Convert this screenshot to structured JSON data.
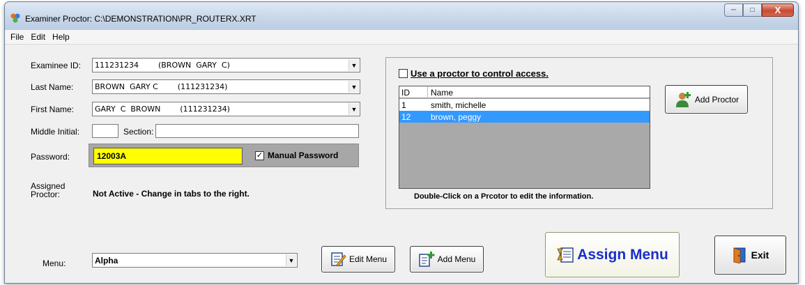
{
  "window": {
    "title": "Examiner Proctor: C:\\DEMONSTRATION\\PR_ROUTERX.XRT"
  },
  "menu": [
    "File",
    "Edit",
    "Help"
  ],
  "form": {
    "examinee_id_label": "Examinee ID:",
    "examinee_id_value": "111231234        (BROWN  GARY  C)",
    "last_name_label": "Last Name:",
    "last_name_value": "BROWN  GARY C        (111231234)",
    "first_name_label": "First Name:",
    "first_name_value": "GARY  C  BROWN        (111231234)",
    "middle_initial_label": "Middle Initial:",
    "middle_initial_value": "",
    "section_label": "Section:",
    "section_value": "",
    "password_label": "Password:",
    "password_value": "12003A",
    "manual_password_label": "Manual Password",
    "manual_password_checked": true,
    "assigned_proctor_label_line1": "Assigned",
    "assigned_proctor_label_line2": "Proctor:",
    "assigned_proctor_status": "Not Active - Change in tabs to the right.",
    "menu_label": "Menu:",
    "menu_value": "Alpha"
  },
  "proctor": {
    "use_proctor_label": "Use a proctor to control access.",
    "use_proctor_checked": false,
    "columns": [
      "ID",
      "Name"
    ],
    "rows": [
      {
        "id": "1",
        "name": "smith, michelle",
        "selected": false
      },
      {
        "id": "12",
        "name": "brown, peggy",
        "selected": true
      }
    ],
    "hint": "Double-Click on a Prcotor to edit the information.",
    "add_proctor_label": "Add Proctor"
  },
  "buttons": {
    "edit_menu": "Edit Menu",
    "add_menu": "Add Menu",
    "assign_menu": "Assign Menu",
    "exit": "Exit"
  },
  "colors": {
    "selection": "#3399ff",
    "password_bg": "#ffff00",
    "assign_text": "#1a2fc8"
  }
}
